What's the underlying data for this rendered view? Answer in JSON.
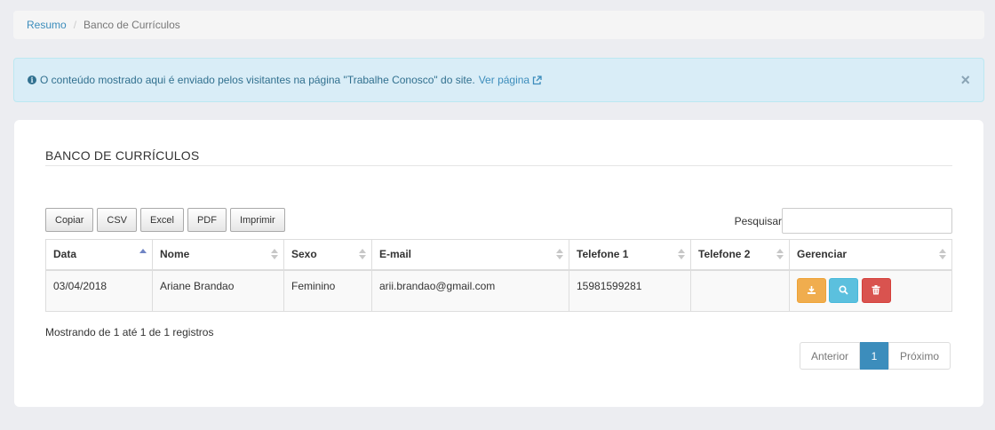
{
  "breadcrumb": {
    "home": "Resumo",
    "separator": "/",
    "current": "Banco de Currículos"
  },
  "alert": {
    "text": "O conteúdo mostrado aqui é enviado pelos visitantes na página \"Trabalhe Conosco\" do site.",
    "link": "Ver página",
    "close": "×",
    "icon": "info-circle-icon"
  },
  "panel": {
    "title": "BANCO DE CURRÍCULOS"
  },
  "toolbar": {
    "copy": "Copiar",
    "csv": "CSV",
    "excel": "Excel",
    "pdf": "PDF",
    "print": "Imprimir"
  },
  "search": {
    "label": "Pesquisar",
    "value": ""
  },
  "table": {
    "headers": [
      "Data",
      "Nome",
      "Sexo",
      "E-mail",
      "Telefone 1",
      "Telefone 2",
      "Gerenciar"
    ],
    "rows": [
      {
        "data": "03/04/2018",
        "nome": "Ariane Brandao",
        "sexo": "Feminino",
        "email": "arii.brandao@gmail.com",
        "telefone1": "15981599281",
        "telefone2": ""
      }
    ],
    "sorted_column": "Data",
    "action_icons": [
      "download-icon",
      "search-icon",
      "trash-icon"
    ]
  },
  "footer": {
    "info": "Mostrando de 1 até 1 de 1 registros"
  },
  "pagination": {
    "prev": "Anterior",
    "current": "1",
    "next": "Próximo"
  },
  "colors": {
    "primary": "#3c8dbc",
    "alert_bg": "#d9edf7",
    "warning": "#f0ad4e",
    "info": "#5bc0de",
    "danger": "#d9534f"
  }
}
